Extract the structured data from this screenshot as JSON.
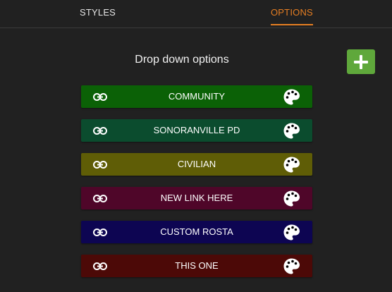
{
  "tabs": {
    "styles_label": "STYLES",
    "options_label": "OPTIONS",
    "active": "OPTIONS",
    "active_color": "#e67e22"
  },
  "section": {
    "title": "Drop down options",
    "add_icon": "plus-icon",
    "add_color": "#5fa83b"
  },
  "options": [
    {
      "label": "COMMUNITY",
      "color": "#0b6106",
      "link_icon": "link-icon",
      "palette_icon": "palette-icon"
    },
    {
      "label": "SONORANVILLE PD",
      "color": "#0b4c2e",
      "link_icon": "link-icon",
      "palette_icon": "palette-icon"
    },
    {
      "label": "CIVILIAN",
      "color": "#5f5d06",
      "link_icon": "link-icon",
      "palette_icon": "palette-icon"
    },
    {
      "label": "NEW LINK HERE",
      "color": "#4f0629",
      "link_icon": "link-icon",
      "palette_icon": "palette-icon"
    },
    {
      "label": "CUSTOM ROSTA",
      "color": "#0d0552",
      "link_icon": "link-icon",
      "palette_icon": "palette-icon"
    },
    {
      "label": "THIS ONE",
      "color": "#4c0907",
      "link_icon": "link-icon",
      "palette_icon": "palette-icon"
    }
  ]
}
